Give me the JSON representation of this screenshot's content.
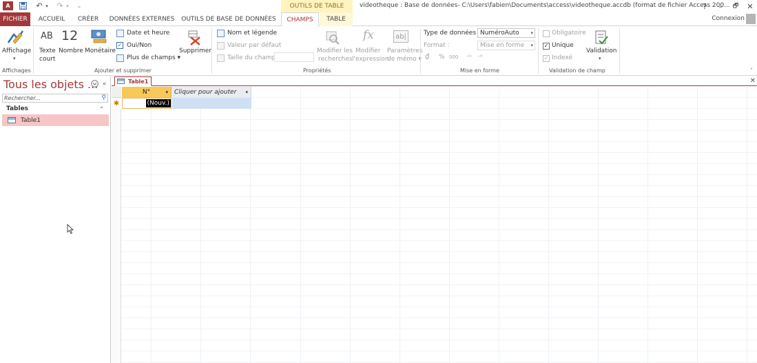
{
  "titlebar": {
    "context_group": "OUTILS DE TABLE",
    "window_title": "videotheque : Base de données- C:\\Users\\fabien\\Documents\\access\\videotheque.accdb (format de fichier Access 200...",
    "help": "?",
    "minimize": "–",
    "restore": "🗗",
    "close": "✕"
  },
  "tabs": {
    "file": "FICHIER",
    "home": "ACCUEIL",
    "create": "CRÉER",
    "external": "DONNÉES EXTERNES",
    "dbtools": "OUTILS DE BASE DE DONNÉES",
    "fields": "CHAMPS",
    "table": "TABLE",
    "connexion": "Connexion"
  },
  "ribbon": {
    "views": {
      "view_label": "Affichage",
      "group": "Affichages"
    },
    "add_delete": {
      "short_text_line1": "Texte",
      "short_text_line2": "court",
      "short_text_icon": "AB",
      "number": "Nombre",
      "number_icon": "12",
      "currency": "Monétaire",
      "date_time": "Date et heure",
      "yes_no": "Oui/Non",
      "more_fields": "Plus de champs ▾",
      "delete": "Supprimer",
      "group": "Ajouter et supprimer"
    },
    "properties": {
      "name_caption": "Nom et légende",
      "default_value": "Valeur par défaut",
      "field_size": "Taille du champ",
      "modify_lookups_line1": "Modifier les",
      "modify_lookups_line2": "recherches",
      "modify_expression_line1": "Modifier",
      "modify_expression_line2": "l'expression",
      "memo_settings_line1": "Paramètres",
      "memo_settings_line2": "de mémo ▾",
      "group": "Propriétés"
    },
    "formatting": {
      "data_type_label": "Type de données :",
      "data_type_value": "NuméroAuto",
      "format_label": "Format :",
      "format_value": "Mise en forme",
      "percent": "%",
      "thousands": "000",
      "group": "Mise en forme"
    },
    "validation": {
      "required": "Obligatoire",
      "unique": "Unique",
      "indexed": "Indexé",
      "validation": "Validation",
      "group": "Validation de champ"
    }
  },
  "nav": {
    "title": "Tous les objets ...",
    "search_placeholder": "Rechercher...",
    "group": "Tables",
    "items": [
      "Table1"
    ]
  },
  "document": {
    "tab": "Table1",
    "columns": [
      "N°",
      "Cliquer pour ajouter"
    ],
    "new_record_marker": "✱",
    "new_value": "(Nouv.)"
  },
  "colors": {
    "accent": "#a4373a",
    "context_tab_bg": "#fdf4bf",
    "selected_nav_item": "#f7c6c4",
    "active_column_header": "#f7c85a"
  }
}
